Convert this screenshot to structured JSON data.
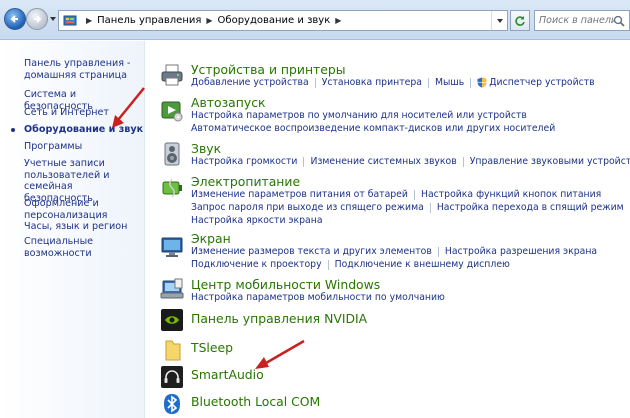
{
  "address_bar": {
    "breadcrumbs": [
      "Панель управления",
      "Оборудование и звук"
    ],
    "search_placeholder": "Поиск в панели упр..."
  },
  "sidebar": {
    "items": [
      {
        "label": "Панель управления - домашняя страница",
        "current": false
      },
      {
        "label": "Система и безопасность",
        "current": false
      },
      {
        "label": "Сеть и Интернет",
        "current": false
      },
      {
        "label": "Оборудование и звук",
        "current": true
      },
      {
        "label": "Программы",
        "current": false
      },
      {
        "label": "Учетные записи пользователей и семейная безопасность",
        "current": false
      },
      {
        "label": "Оформление и персонализация",
        "current": false
      },
      {
        "label": "Часы, язык и регион",
        "current": false
      },
      {
        "label": "Специальные возможности",
        "current": false
      }
    ]
  },
  "categories": [
    {
      "title": "Устройства и принтеры",
      "icon": "printer-icon",
      "links": [
        [
          "Добавление устройства",
          "Установка принтера",
          "Мышь",
          "Диспетчер устройств"
        ]
      ]
    },
    {
      "title": "Автозапуск",
      "icon": "autoplay-icon",
      "links": [
        [
          "Настройка параметров по умолчанию для носителей или устройств"
        ],
        [
          "Автоматическое воспроизведение компакт-дисков или других носителей"
        ]
      ]
    },
    {
      "title": "Звук",
      "icon": "speaker-icon",
      "links": [
        [
          "Настройка громкости",
          "Изменение системных звуков",
          "Управление звуковыми устройствами"
        ]
      ]
    },
    {
      "title": "Электропитание",
      "icon": "battery-icon",
      "links": [
        [
          "Изменение параметров питания от батарей",
          "Настройка функций кнопок питания"
        ],
        [
          "Запрос пароля при выходе из спящего режима",
          "Настройка перехода в спящий режим"
        ],
        [
          "Настройка яркости экрана"
        ]
      ]
    },
    {
      "title": "Экран",
      "icon": "monitor-icon",
      "links": [
        [
          "Изменение размеров текста и других элементов",
          "Настройка разрешения экрана"
        ],
        [
          "Подключение к проектору",
          "Подключение к внешнему дисплею"
        ]
      ]
    },
    {
      "title": "Центр мобильности Windows",
      "icon": "mobility-center-icon",
      "links": [
        [
          "Настройка параметров мобильности по умолчанию"
        ]
      ]
    },
    {
      "title": "Панель управления NVIDIA",
      "icon": "nvidia-icon",
      "links": []
    },
    {
      "title": "TSleep",
      "icon": "folder-icon",
      "links": []
    },
    {
      "title": "SmartAudio",
      "icon": "headphones-icon",
      "links": []
    },
    {
      "title": "Bluetooth Local COM",
      "icon": "bluetooth-icon",
      "links": []
    }
  ],
  "colors": {
    "link": "#1e3287",
    "category_title": "#277600",
    "annotation_arrow": "#cc1f1f"
  }
}
